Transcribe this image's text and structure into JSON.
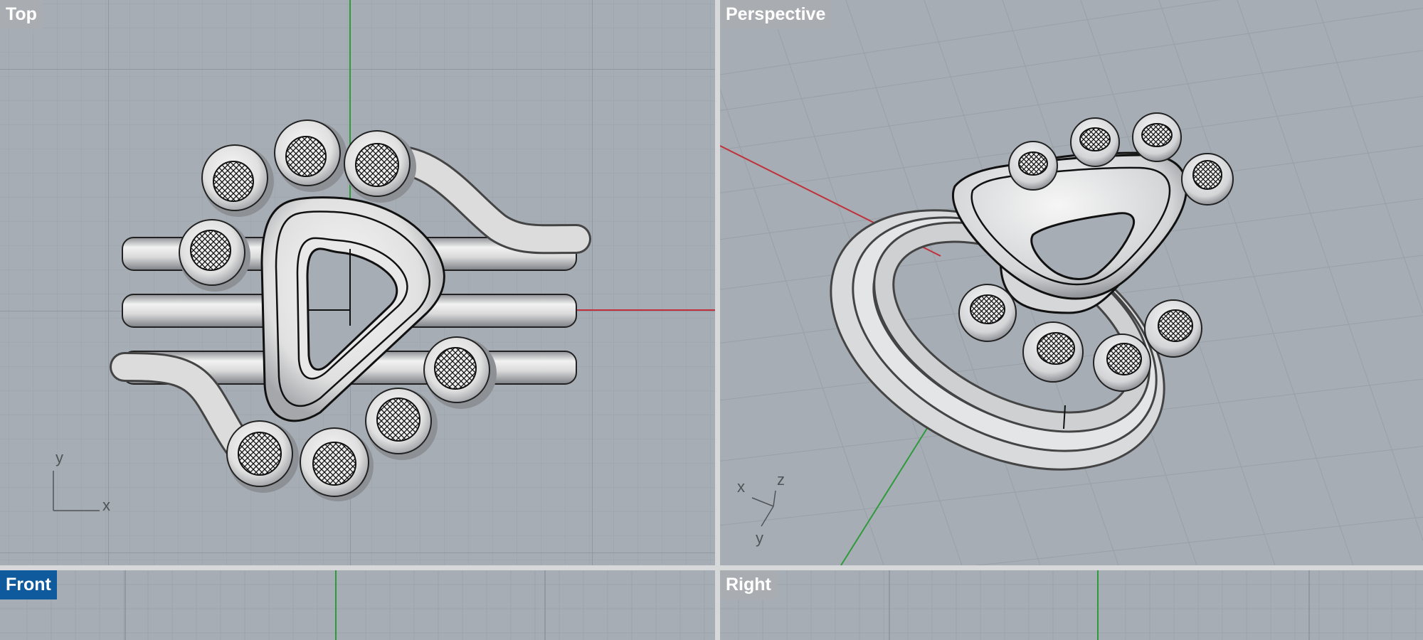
{
  "viewports": {
    "top": {
      "label": "Top",
      "active": false
    },
    "perspective": {
      "label": "Perspective",
      "active": false
    },
    "front": {
      "label": "Front",
      "active": true
    },
    "right": {
      "label": "Right",
      "active": false
    }
  },
  "axis_labels": {
    "top": {
      "x": "x",
      "y": "y"
    },
    "perspective": {
      "x": "x",
      "y": "y",
      "z": "z"
    }
  },
  "colors": {
    "viewport_bg": "#a7adb5",
    "grid_minor": "#9da3ab",
    "grid_major": "#8f959e",
    "x_axis": "#c0313b",
    "y_axis": "#2f9a3b",
    "active_label": "#0e5a9c",
    "separator": "#d6d8da"
  },
  "model": {
    "name": "ring-with-triangle-bezel",
    "gem_count_top_view": 8
  }
}
